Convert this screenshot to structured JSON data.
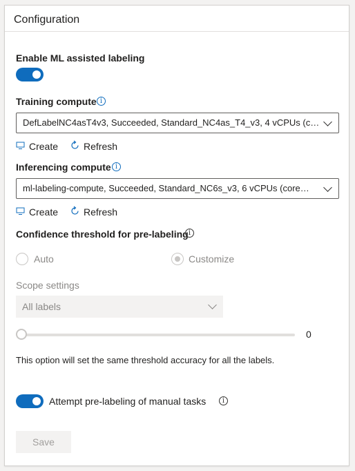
{
  "header": {
    "title": "Configuration"
  },
  "ml_assist": {
    "label": "Enable ML assisted labeling",
    "enabled": true
  },
  "training": {
    "label": "Training compute",
    "selected": "DefLabelNC4asT4v3, Succeeded, Standard_NC4as_T4_v3, 4 vCPUs (c…",
    "create_label": "Create",
    "refresh_label": "Refresh"
  },
  "inferencing": {
    "label": "Inferencing compute",
    "selected": "ml-labeling-compute, Succeeded, Standard_NC6s_v3, 6 vCPUs (core…",
    "create_label": "Create",
    "refresh_label": "Refresh"
  },
  "confidence": {
    "label": "Confidence threshold for pre-labeling",
    "option_auto": "Auto",
    "option_customize": "Customize",
    "selected": "Customize"
  },
  "scope": {
    "label": "Scope settings",
    "selected": "All labels",
    "slider_value": "0",
    "note": "This option will set the same threshold accuracy for all the labels."
  },
  "prelabel": {
    "label": "Attempt pre-labeling of manual tasks",
    "enabled": true
  },
  "actions": {
    "save_label": "Save"
  },
  "colors": {
    "accent": "#0f6cbd",
    "disabled": "#a19f9d"
  },
  "icons": {
    "info": "info-icon",
    "create": "monitor-icon",
    "refresh": "refresh-icon",
    "dropdown": "chevron-down-icon"
  }
}
